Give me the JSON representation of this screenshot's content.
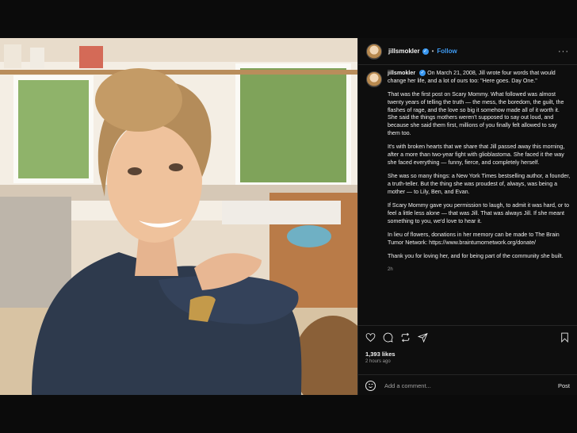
{
  "post": {
    "username": "jillsmokler",
    "verified_mark": "✓",
    "separator": "•",
    "follow_label": "Follow",
    "more_label": "···",
    "icons": [
      "avatar",
      "verified-badge-icon",
      "more-options-icon",
      "heart-icon",
      "comment-icon",
      "repost-icon",
      "share-icon",
      "bookmark-icon",
      "emoji-icon"
    ]
  },
  "caption": {
    "username": "jillsmokler",
    "paragraphs": [
      "On March 21, 2008, Jill wrote four words that would change her life, and a lot of ours too: \"Here goes. Day One.\"",
      "That was the first post on Scary Mommy. What followed was almost twenty years of telling the truth — the mess, the boredom, the guilt, the flashes of rage, and the love so big it somehow made all of it worth it. She said the things mothers weren't supposed to say out loud, and because she said them first, millions of you finally felt allowed to say them too.",
      "It's with broken hearts that we share that Jill passed away this morning, after a more than two-year fight with glioblastoma. She faced it the way she faced everything — funny, fierce, and completely herself.",
      "She was so many things: a New York Times bestselling author, a founder, a truth-teller. But the thing she was proudest of, always, was being a mother — to Lily, Ben, and Evan.",
      "If Scary Mommy gave you permission to laugh, to admit it was hard, or to feel a little less alone — that was Jill. That was always Jill. If she meant something to you, we'd love to hear it.",
      "In lieu of flowers, donations in her memory can be made to The Brain Tumor Network: https://www.braintumornetwork.org/donate/",
      "Thank you for loving her, and for being part of the community she built."
    ],
    "time": "2h"
  },
  "stats": {
    "likes": "1,393 likes",
    "ago": "2 hours ago"
  },
  "comment_box": {
    "placeholder": "Add a comment...",
    "post_label": "Post"
  }
}
